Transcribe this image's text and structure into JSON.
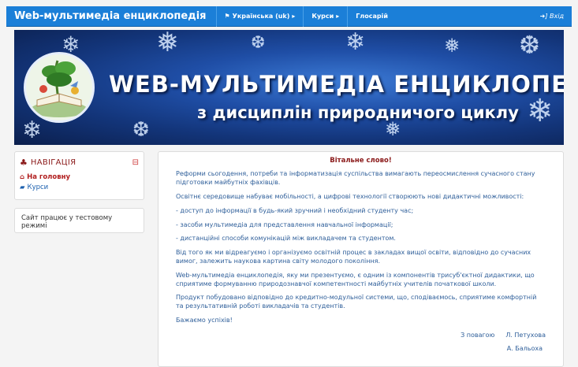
{
  "header": {
    "brand": "Web-мультимедіа енциклопедія",
    "nav": [
      {
        "label": "Українська (uk)",
        "has_flag": true
      },
      {
        "label": "Курси"
      },
      {
        "label": "Глосарій"
      }
    ],
    "login": "Вхід"
  },
  "banner": {
    "title": "WEB-МУЛЬТИМЕДІА ЕНЦИКЛОПЕДІЯ",
    "subtitle": "з дисциплін природничого циклу"
  },
  "navigation": {
    "title": "НАВІГАЦІЯ",
    "items": [
      {
        "label": "На головну",
        "icon": "home-icon"
      },
      {
        "label": "Курси",
        "icon": "folder-icon"
      }
    ]
  },
  "notice": "Сайт працює у тестовому режимі",
  "welcome": {
    "title": "Вітальне слово!",
    "paragraphs": [
      "Реформи сьогодення, потреби та інформатизація суспільства вимагають переосмислення сучасного стану підготовки майбутніх фахівців.",
      "Освітнє середовище набуває мобільності, а цифрові технології створюють нові дидактичні можливості:",
      "- доступ до інформації в будь-який зручний і необхідний студенту час;",
      "- засоби мультимедіа для представлення навчальної інформації;",
      "- дистанційні способи комунікацій між викладачем та студентом.",
      "Від того як ми відреагуємо і організуємо освітній процес в закладах вищої освіти, відповідно до сучасних вимог, залежить наукова картина світу молодого покоління.",
      "Web-мультимедіа енциклопедія, яку ми презентуємо, є одним із компонентів трисуб'єктної дидактики, що сприятиме формуванню природознавчої компетентності майбутніх учителів початкової школи.",
      "Продукт побудовано відповідно до кредитно-модульної системи, що, сподіваємось, сприятиме комфортній та результативній роботі викладачів та студентів.",
      "Бажаємо успіхів!"
    ],
    "regards": "З повагою",
    "author1": "Л. Петухова",
    "author2": "А. Бальоха"
  },
  "colors": {
    "navbar": "#1b7fd8",
    "accent_red": "#8b1a1a",
    "text_blue": "#2f5f9a"
  }
}
